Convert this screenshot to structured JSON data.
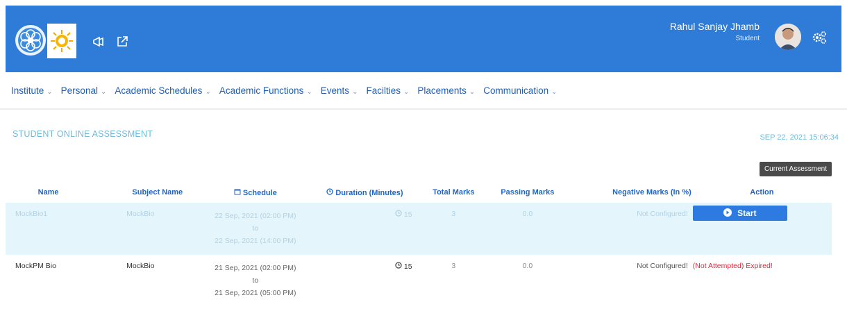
{
  "header": {
    "user_name": "Rahul Sanjay Jhamb",
    "user_role": "Student",
    "colors": {
      "bar": "#2f7bd8"
    },
    "icons": [
      "institute-logo-icon",
      "sun-logo-icon",
      "announcement-icon",
      "external-link-icon",
      "settings-icon"
    ]
  },
  "nav": {
    "items": [
      {
        "label": "Institute"
      },
      {
        "label": "Personal"
      },
      {
        "label": "Academic Schedules"
      },
      {
        "label": "Academic Functions"
      },
      {
        "label": "Events"
      },
      {
        "label": "Facilties"
      },
      {
        "label": "Placements"
      },
      {
        "label": "Communication"
      }
    ]
  },
  "page": {
    "title": "STUDENT ONLINE ASSESSMENT",
    "datetime": "SEP 22, 2021  15:06:34",
    "current_button": "Current Assessment"
  },
  "table": {
    "headers": {
      "name": "Name",
      "subject": "Subject Name",
      "schedule": "Schedule",
      "duration": "Duration (Minutes)",
      "total": "Total Marks",
      "passing": "Passing Marks",
      "negative": "Negative Marks (In %)",
      "action": "Action"
    },
    "rows": [
      {
        "name": "MockBio1",
        "subject": "MockBio",
        "sched_from": "22 Sep, 2021 (02:00 PM)",
        "sched_to_word": "to",
        "sched_to": "22 Sep, 2021 (14:00 PM)",
        "duration": "15",
        "total": "3",
        "passing": "0.0",
        "negative": "Not Configured!",
        "action_label": "Start"
      },
      {
        "name": "MockPM Bio",
        "subject": "MockBio",
        "sched_from": "21 Sep, 2021 (02:00 PM)",
        "sched_to_word": "to",
        "sched_to": "21 Sep, 2021 (05:00 PM)",
        "duration": "15",
        "total": "3",
        "passing": "0.0",
        "negative": "Not Configured!",
        "action_label": "(Not Attempted) Expired!"
      }
    ]
  }
}
